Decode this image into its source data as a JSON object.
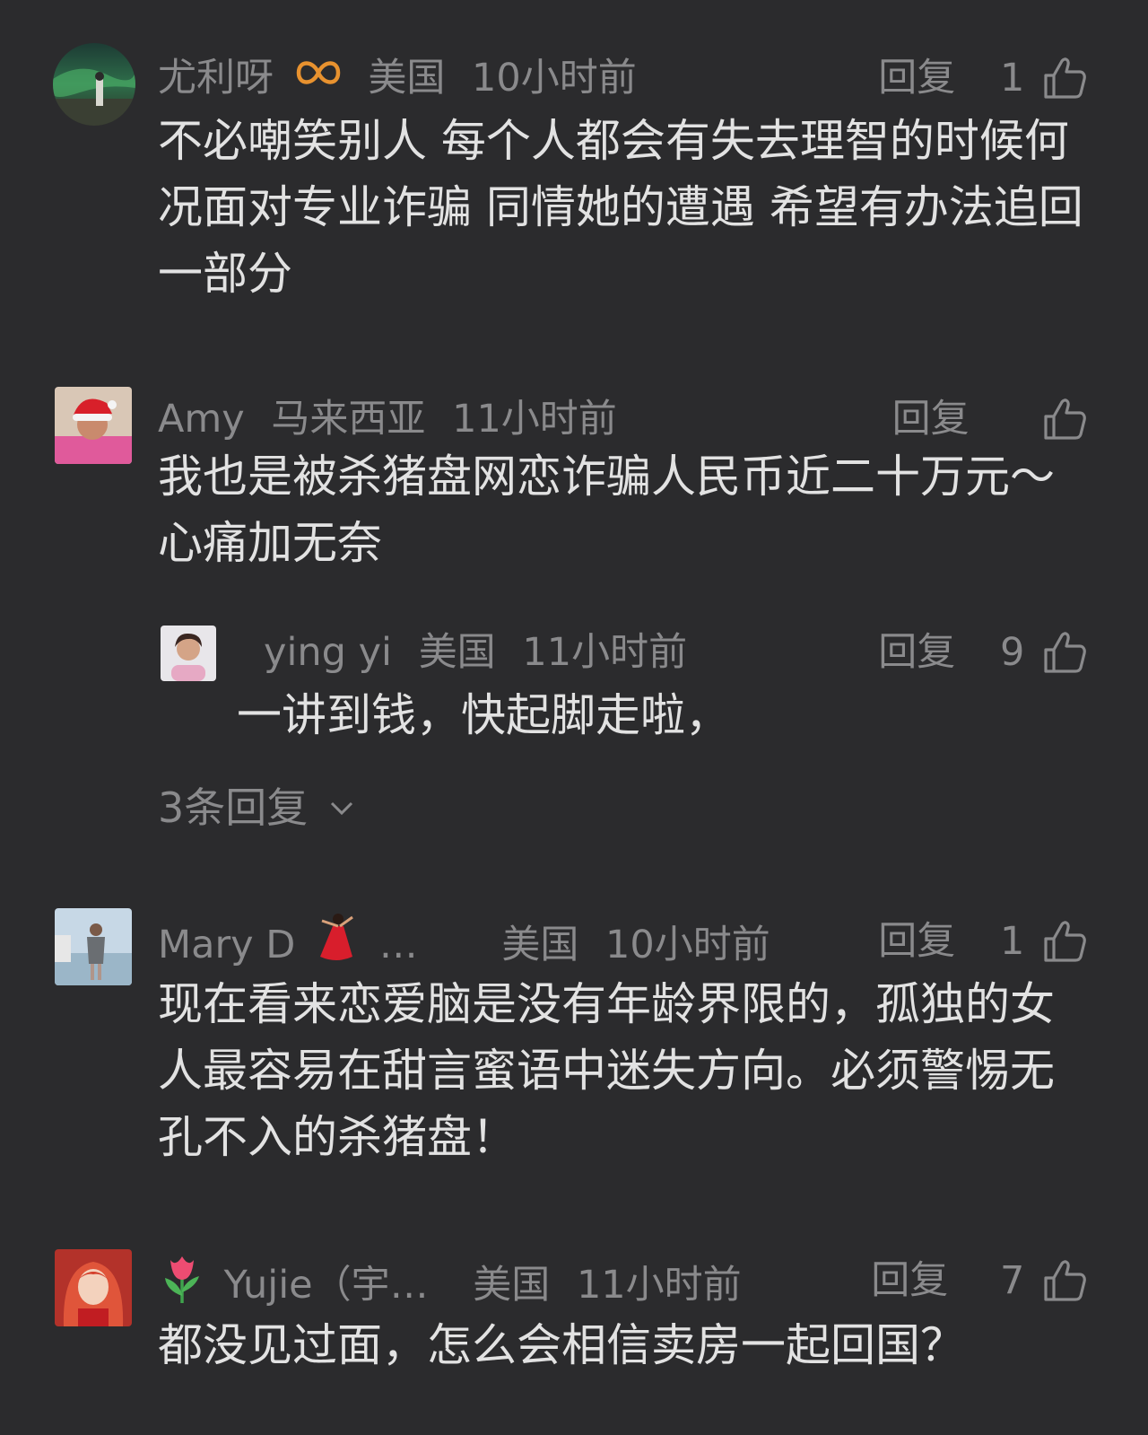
{
  "comments": [
    {
      "username": "尤利呀",
      "badge": "infinity-badge-icon",
      "location": "美国",
      "time": "10小时前",
      "reply_label": "回复",
      "likes": "1",
      "text": "不必嘲笑别人 每个人都会有失去理智的时候何况面对专业诈骗 同情她的遭遇 希望有办法追回一部分"
    },
    {
      "username": "Amy",
      "location": "马来西亚",
      "time": "11小时前",
      "reply_label": "回复",
      "likes": "",
      "text": "我也是被杀猪盘网恋诈骗人民币近二十万元～心痛加无奈",
      "replies": [
        {
          "username": "ying yi",
          "location": "美国",
          "time": "11小时前",
          "reply_label": "回复",
          "likes": "9",
          "text": "一讲到钱，快起脚走啦，"
        }
      ],
      "more_replies_label": "3条回复"
    },
    {
      "username": "Mary D",
      "username_suffix": "…",
      "location": "美国",
      "time": "10小时前",
      "reply_label": "回复",
      "likes": "1",
      "text": "现在看来恋爱脑是没有年龄界限的，孤独的女人最容易在甜言蜜语中迷失方向。必须警惕无孔不入的杀猪盘！"
    },
    {
      "username": "Yujie（宇…",
      "location": "美国",
      "time": "11小时前",
      "reply_label": "回复",
      "likes": "7",
      "text": "都没见过面，怎么会相信卖房一起回国？"
    }
  ],
  "colors": {
    "background": "#2b2b2d",
    "meta_text": "#8a8a8c",
    "body_text": "#e2e2e2",
    "badge": "#e8922f"
  }
}
